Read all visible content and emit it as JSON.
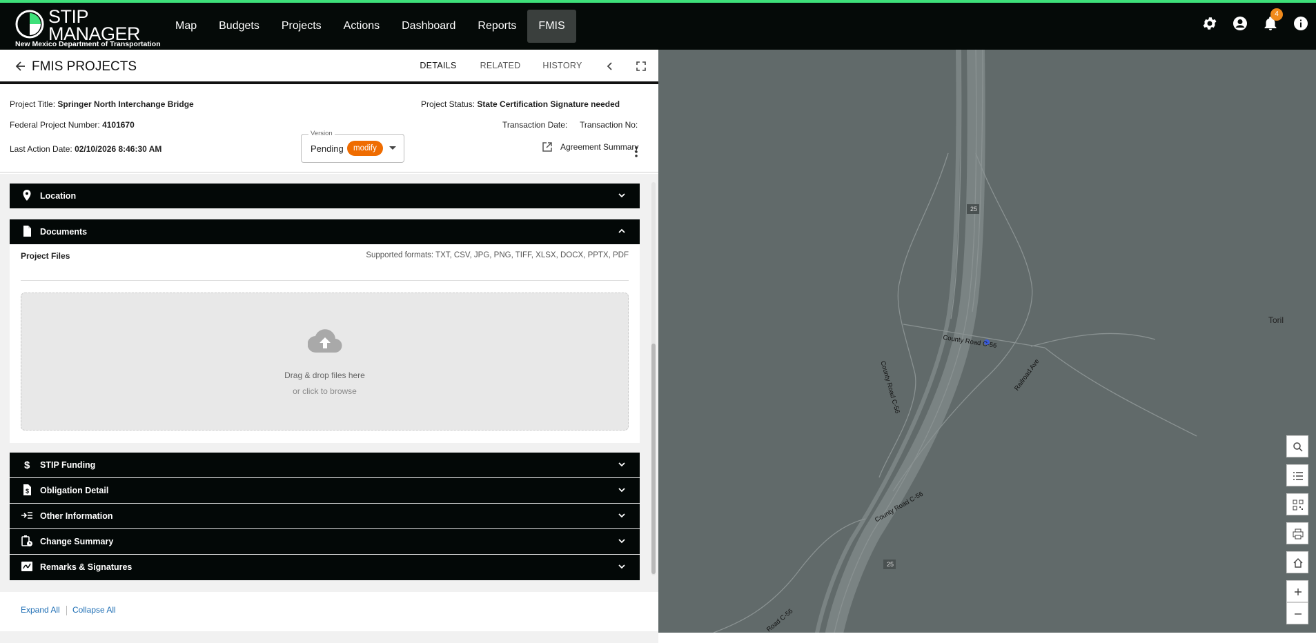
{
  "app": {
    "logo_title_line1": "STIP",
    "logo_title_line2": "MANAGER",
    "logo_subtitle": "New Mexico Department of Transportation",
    "accent_color": "#3ee07a"
  },
  "nav": {
    "items": [
      {
        "label": "Map"
      },
      {
        "label": "Budgets"
      },
      {
        "label": "Projects"
      },
      {
        "label": "Actions"
      },
      {
        "label": "Dashboard"
      },
      {
        "label": "Reports"
      },
      {
        "label": "FMIS",
        "active": true
      }
    ]
  },
  "top_icons": {
    "settings": "gear-icon",
    "account": "account-icon",
    "notifications": "bell-icon",
    "notification_count": "4",
    "info": "info-icon"
  },
  "panel": {
    "title": "FMIS PROJECTS",
    "tabs": [
      {
        "label": "DETAILS",
        "active": true
      },
      {
        "label": "RELATED"
      },
      {
        "label": "HISTORY"
      }
    ]
  },
  "project": {
    "title_label": "Project Title: ",
    "title_value": "Springer North Interchange Bridge",
    "federal_label": "Federal Project Number: ",
    "federal_value": "4101670",
    "last_action_label": "Last Action Date: ",
    "last_action_value": "02/10/2026 8:46:30 AM",
    "status_label": "Project Status: ",
    "status_value": "State Certification Signature needed",
    "transaction_date_label": "Transaction Date:",
    "transaction_no_label": "Transaction No:",
    "agreement_summary": "Agreement Summary",
    "version_legend": "Version",
    "version_value": "Pending",
    "version_chip": "modify"
  },
  "sections": {
    "location": "Location",
    "documents": "Documents",
    "stip_funding": "STIP Funding",
    "obligation_detail": "Obligation Detail",
    "other_information": "Other Information",
    "change_summary": "Change Summary",
    "remarks": "Remarks & Signatures"
  },
  "documents": {
    "project_files": "Project Files",
    "formats": "Supported formats: TXT, CSV, JPG, PNG, TIFF, XLSX, DOCX, PPTX, PDF",
    "drop_main": "Drag & drop files here",
    "drop_sub": "or click to browse"
  },
  "footer": {
    "expand_all": "Expand All",
    "collapse_all": "Collapse All"
  },
  "map": {
    "labels": {
      "county_road_c56_top": "County Road C-56",
      "county_road_c56_left": "County Road C-56",
      "county_road_c56_bottom": "County Road C-56",
      "railroad_ave": "Railroad Ave",
      "toril": "Toril",
      "shield_25_top": "25",
      "shield_25_bottom": "25",
      "road_bottom_left": "Road C-56"
    }
  }
}
